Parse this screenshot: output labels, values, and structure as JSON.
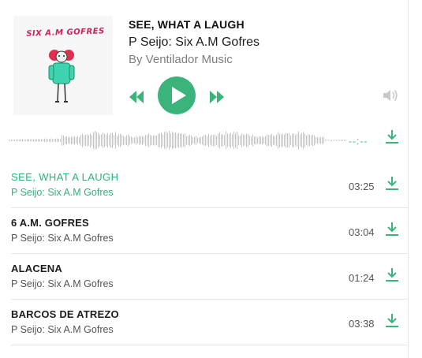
{
  "colors": {
    "accent": "#3ab47a",
    "text": "#1c1c1c",
    "muted": "#7e7e7e"
  },
  "header": {
    "cover_text": "SIX A.M GOFRES",
    "title": "SEE, WHAT A LAUGH",
    "subtitle": "P Seijo: Six A.M Gofres",
    "byline": "By Ventilador Music",
    "total_time": "--:--"
  },
  "controls": {
    "prev_icon": "rewind-icon",
    "play_icon": "play-icon",
    "next_icon": "fast-forward-icon",
    "volume_icon": "speaker-icon",
    "download_icon": "download-icon"
  },
  "tracks": [
    {
      "title": "SEE, WHAT A LAUGH",
      "artist": "P Seijo: Six A.M Gofres",
      "duration": "03:25",
      "active": true
    },
    {
      "title": "6 A.M. GOFRES",
      "artist": "P Seijo: Six A.M Gofres",
      "duration": "03:04",
      "active": false
    },
    {
      "title": "ALACENA",
      "artist": "P Seijo: Six A.M Gofres",
      "duration": "01:24",
      "active": false
    },
    {
      "title": "BARCOS DE ATREZO",
      "artist": "P Seijo: Six A.M Gofres",
      "duration": "03:38",
      "active": false
    }
  ]
}
